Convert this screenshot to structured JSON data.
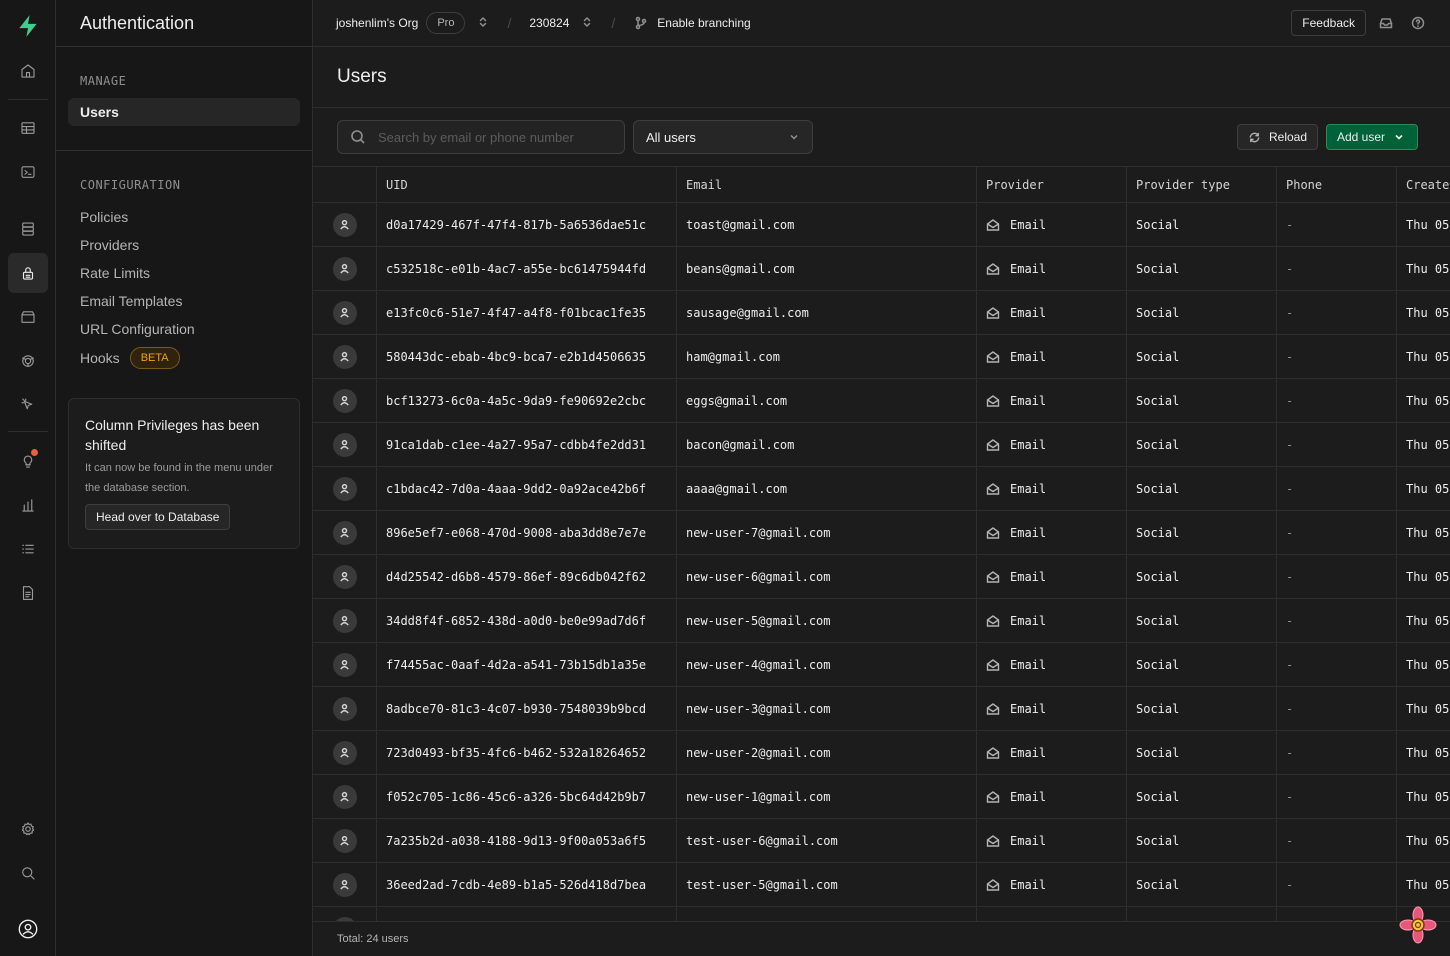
{
  "app": {
    "section_title": "Authentication"
  },
  "topbar": {
    "org": "joshenlim's Org",
    "plan": "Pro",
    "project": "230824",
    "branching": "Enable branching",
    "feedback": "Feedback"
  },
  "menu": {
    "manage_title": "MANAGE",
    "manage_items": [
      "Users"
    ],
    "config_title": "CONFIGURATION",
    "config_items": [
      "Policies",
      "Providers",
      "Rate Limits",
      "Email Templates",
      "URL Configuration",
      "Hooks"
    ],
    "hooks_badge": "BETA",
    "notice": {
      "title": "Column Privileges has been shifted",
      "body": "It can now be found in the menu under the database section.",
      "button": "Head over to Database"
    }
  },
  "page": {
    "title": "Users"
  },
  "toolbar": {
    "search_placeholder": "Search by email or phone number",
    "filter_value": "All users",
    "reload": "Reload",
    "add_user": "Add user"
  },
  "table": {
    "headers": [
      "UID",
      "Email",
      "Provider",
      "Provider type",
      "Phone",
      "Create"
    ],
    "rows": [
      {
        "uid": "d0a17429-467f-47f4-817b-5a6536dae51c",
        "email": "toast@gmail.com",
        "provider": "Email",
        "provider_type": "Social",
        "phone": "-",
        "created": "Thu 05"
      },
      {
        "uid": "c532518c-e01b-4ac7-a55e-bc61475944fd",
        "email": "beans@gmail.com",
        "provider": "Email",
        "provider_type": "Social",
        "phone": "-",
        "created": "Thu 05"
      },
      {
        "uid": "e13fc0c6-51e7-4f47-a4f8-f01bcac1fe35",
        "email": "sausage@gmail.com",
        "provider": "Email",
        "provider_type": "Social",
        "phone": "-",
        "created": "Thu 05"
      },
      {
        "uid": "580443dc-ebab-4bc9-bca7-e2b1d4506635",
        "email": "ham@gmail.com",
        "provider": "Email",
        "provider_type": "Social",
        "phone": "-",
        "created": "Thu 05"
      },
      {
        "uid": "bcf13273-6c0a-4a5c-9da9-fe90692e2cbc",
        "email": "eggs@gmail.com",
        "provider": "Email",
        "provider_type": "Social",
        "phone": "-",
        "created": "Thu 05"
      },
      {
        "uid": "91ca1dab-c1ee-4a27-95a7-cdbb4fe2dd31",
        "email": "bacon@gmail.com",
        "provider": "Email",
        "provider_type": "Social",
        "phone": "-",
        "created": "Thu 05"
      },
      {
        "uid": "c1bdac42-7d0a-4aaa-9dd2-0a92ace42b6f",
        "email": "aaaa@gmail.com",
        "provider": "Email",
        "provider_type": "Social",
        "phone": "-",
        "created": "Thu 05"
      },
      {
        "uid": "896e5ef7-e068-470d-9008-aba3dd8e7e7e",
        "email": "new-user-7@gmail.com",
        "provider": "Email",
        "provider_type": "Social",
        "phone": "-",
        "created": "Thu 05"
      },
      {
        "uid": "d4d25542-d6b8-4579-86ef-89c6db042f62",
        "email": "new-user-6@gmail.com",
        "provider": "Email",
        "provider_type": "Social",
        "phone": "-",
        "created": "Thu 05"
      },
      {
        "uid": "34dd8f4f-6852-438d-a0d0-be0e99ad7d6f",
        "email": "new-user-5@gmail.com",
        "provider": "Email",
        "provider_type": "Social",
        "phone": "-",
        "created": "Thu 05"
      },
      {
        "uid": "f74455ac-0aaf-4d2a-a541-73b15db1a35e",
        "email": "new-user-4@gmail.com",
        "provider": "Email",
        "provider_type": "Social",
        "phone": "-",
        "created": "Thu 05"
      },
      {
        "uid": "8adbce70-81c3-4c07-b930-7548039b9bcd",
        "email": "new-user-3@gmail.com",
        "provider": "Email",
        "provider_type": "Social",
        "phone": "-",
        "created": "Thu 05"
      },
      {
        "uid": "723d0493-bf35-4fc6-b462-532a18264652",
        "email": "new-user-2@gmail.com",
        "provider": "Email",
        "provider_type": "Social",
        "phone": "-",
        "created": "Thu 05"
      },
      {
        "uid": "f052c705-1c86-45c6-a326-5bc64d42b9b7",
        "email": "new-user-1@gmail.com",
        "provider": "Email",
        "provider_type": "Social",
        "phone": "-",
        "created": "Thu 05"
      },
      {
        "uid": "7a235b2d-a038-4188-9d13-9f00a053a6f5",
        "email": "test-user-6@gmail.com",
        "provider": "Email",
        "provider_type": "Social",
        "phone": "-",
        "created": "Thu 05"
      },
      {
        "uid": "36eed2ad-7cdb-4e89-b1a5-526d418d7bea",
        "email": "test-user-5@gmail.com",
        "provider": "Email",
        "provider_type": "Social",
        "phone": "-",
        "created": "Thu 05"
      }
    ]
  },
  "footer": {
    "total": "Total: 24 users"
  },
  "colors": {
    "brand": "#3ecf8e",
    "add_button": "#006239",
    "beta": "#f1a10d",
    "notification": "#e5613f"
  },
  "icons": {
    "rail": [
      "supabase-logo-icon",
      "home-icon",
      "table-editor-icon",
      "sql-editor-icon",
      "database-icon",
      "auth-lock-icon",
      "storage-icon",
      "realtime-icon",
      "edge-functions-icon",
      "advisors-icon",
      "reports-icon",
      "logs-icon",
      "api-docs-icon",
      "settings-icon",
      "search-icon",
      "profile-icon"
    ]
  }
}
